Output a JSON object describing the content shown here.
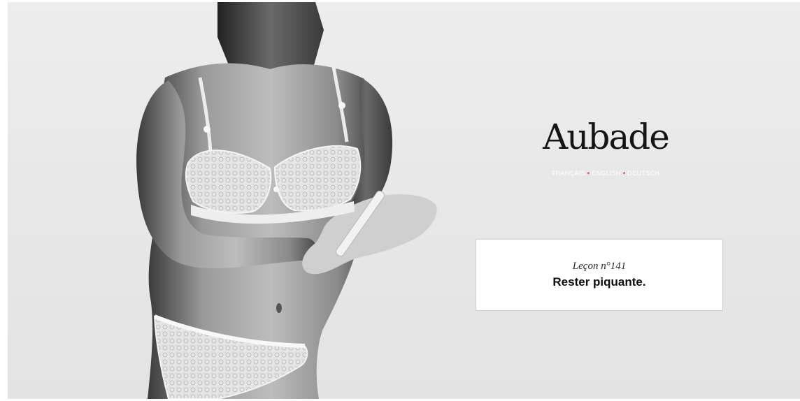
{
  "brand": {
    "name": "Aubade"
  },
  "languages": [
    {
      "label": "FRANÇAIS"
    },
    {
      "label": "ENGLISH"
    },
    {
      "label": "DEUTSCH"
    }
  ],
  "language_separator": "•",
  "lesson": {
    "number": "Leçon n°141",
    "title": "Rester piquante."
  },
  "colors": {
    "background": "#e9e9e9",
    "accent": "#d3155b",
    "card": "#ffffff",
    "text": "#0c0c0c"
  },
  "hero_image": {
    "icon": "model-lingerie-photo"
  }
}
